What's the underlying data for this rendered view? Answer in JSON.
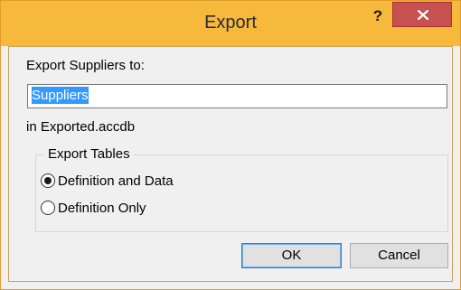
{
  "window": {
    "title": "Export",
    "help_label": "?",
    "close_icon": "close-icon",
    "accent_color": "#f6b93b",
    "close_color": "#c75050"
  },
  "export": {
    "prompt_label": "Export Suppliers to:",
    "name_value": "Suppliers",
    "destination_label": "in Exported.accdb"
  },
  "tables_group": {
    "title": "Export Tables",
    "options": [
      {
        "label": "Definition and Data",
        "selected": true
      },
      {
        "label": "Definition Only",
        "selected": false
      }
    ]
  },
  "buttons": {
    "ok_label": "OK",
    "cancel_label": "Cancel"
  }
}
